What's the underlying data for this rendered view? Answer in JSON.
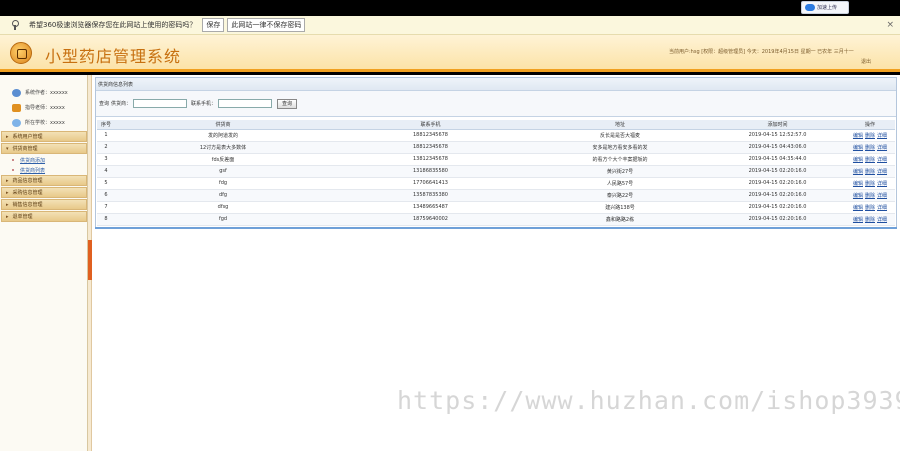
{
  "top_strip": {
    "upload_label": "加速上传"
  },
  "password_bar": {
    "message": "希望360极速浏览器保存您在此网站上使用的密码吗？",
    "save_label": "保存",
    "never_label": "此网站一律不保存密码",
    "close_glyph": "×"
  },
  "header": {
    "title": "小型药店管理系统",
    "user_info": "当前用户:hsg [权限：超级管理员] 今天：2019年4月15日 星期一 已农年 三月十一",
    "logout": "退出"
  },
  "sidebar": {
    "info": [
      {
        "label": "系统作者：xxxxxx",
        "icon": "author-icon"
      },
      {
        "label": "指导老师：xxxxx",
        "icon": "teacher-icon"
      },
      {
        "label": "所在学校：xxxxx",
        "icon": "school-icon"
      }
    ],
    "menu": [
      {
        "label": "系统用户管理"
      },
      {
        "label": "供货商管理"
      },
      {
        "label": "药品信息管理"
      },
      {
        "label": "采购信息管理"
      },
      {
        "label": "销售信息管理"
      },
      {
        "label": "退单管理"
      }
    ],
    "submenu": [
      {
        "label": "供货商添加"
      },
      {
        "label": "供货商列表"
      }
    ]
  },
  "main": {
    "panel_title": "供货商信息列表",
    "search": {
      "prefix": "查询",
      "supplier_label": "供货商：",
      "phone_label": "联系手机：",
      "supplier_value": "",
      "phone_value": "",
      "button": "查询"
    },
    "columns": [
      "序号",
      "供货商",
      "联系手机",
      "地址",
      "添加时间",
      "操作"
    ],
    "ops": [
      "编辑",
      "删除",
      "详细"
    ],
    "rows": [
      {
        "no": "1",
        "name": "发的阿道发的",
        "phone": "18812345678",
        "addr": "反长是是否大福麦",
        "time": "2019-04-15 12:52:57.0"
      },
      {
        "no": "2",
        "name": "12讨方是表大多数体",
        "phone": "18812345678",
        "addr": "安多是地方看安多看的发",
        "time": "2019-04-15 04:43:06.0"
      },
      {
        "no": "3",
        "name": "fds反差面",
        "phone": "13812345678",
        "addr": "的看方个大个丰案据坂的",
        "time": "2019-04-15 04:35:44.0"
      },
      {
        "no": "4",
        "name": "gsf",
        "phone": "13186835580",
        "addr": "黄兴街27号",
        "time": "2019-04-15 02:20:16.0"
      },
      {
        "no": "5",
        "name": "fdg",
        "phone": "17706641413",
        "addr": "人民路57号",
        "time": "2019-04-15 02:20:16.0"
      },
      {
        "no": "6",
        "name": "dfg",
        "phone": "13587835380",
        "addr": "泰兴路22号",
        "time": "2019-04-15 02:20:16.0"
      },
      {
        "no": "7",
        "name": "dfsg",
        "phone": "13489665487",
        "addr": "建兴路138号",
        "time": "2019-04-15 02:20:16.0"
      },
      {
        "no": "8",
        "name": "fgd",
        "phone": "18759640002",
        "addr": "鑫和路路2栋",
        "time": "2019-04-15 02:20:16.0"
      }
    ]
  },
  "watermark": "https://www.huzhan.com/ishop39397"
}
